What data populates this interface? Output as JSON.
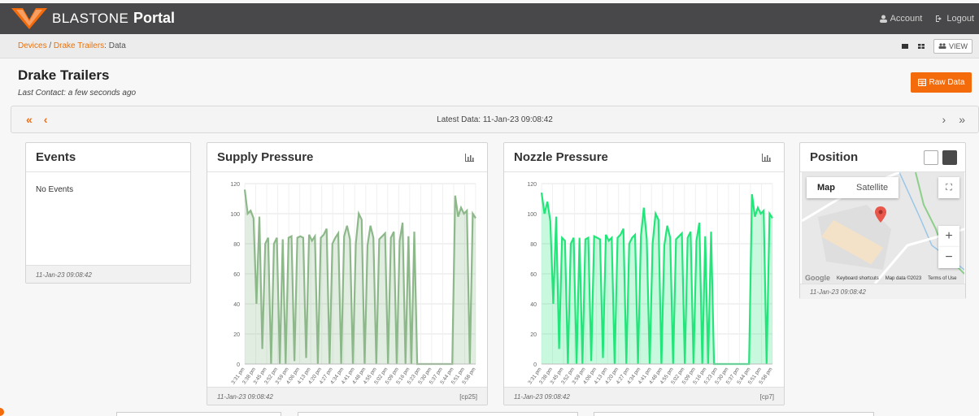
{
  "header": {
    "brand": "BLASTONE",
    "portal": "Portal",
    "account": "Account",
    "logout": "Logout"
  },
  "breadcrumb": {
    "devices": "Devices",
    "sep": "/",
    "trailer": "Drake Trailers",
    "current": ": Data",
    "view_label": "VIEW"
  },
  "page": {
    "title": "Drake Trailers",
    "last_contact": "Last Contact: a few seconds ago",
    "raw_data": "Raw Data"
  },
  "nav": {
    "first": "«",
    "prev": "‹",
    "latest": "Latest Data: 11-Jan-23 09:08:42",
    "next": "›",
    "last": "»"
  },
  "events": {
    "title": "Events",
    "body": "No Events",
    "timestamp": "11-Jan-23 09:08:42"
  },
  "supply": {
    "title": "Supply Pressure",
    "timestamp": "11-Jan-23 09:08:42",
    "code": "[cp25]"
  },
  "nozzle": {
    "title": "Nozzle Pressure",
    "timestamp": "11-Jan-23 09:08:42",
    "code": "[cp7]"
  },
  "position": {
    "title": "Position",
    "map_tab": "Map",
    "satellite_tab": "Satellite",
    "google": "Google",
    "shortcuts": "Keyboard shortcuts",
    "mapdata": "Map data ©2023",
    "terms": "Terms of Use",
    "timestamp": "11-Jan-23 09:08:42"
  },
  "colors": {
    "orange": "#f46b0b",
    "supply": "#8db88a",
    "nozzle": "#22e67a",
    "topbar": "#48484a"
  },
  "chart_data": [
    {
      "type": "area",
      "name": "supply",
      "ylim": [
        0,
        120
      ],
      "yticks": [
        0,
        20,
        40,
        60,
        80,
        100,
        120
      ],
      "x": [
        "3:31 pm",
        "3:38 pm",
        "3:45 pm",
        "3:52 pm",
        "3:59 pm",
        "4:06 pm",
        "4:13 pm",
        "4:20 pm",
        "4:27 pm",
        "4:34 pm",
        "4:41 pm",
        "4:48 pm",
        "4:55 pm",
        "5:02 pm",
        "5:09 pm",
        "5:16 pm",
        "5:23 pm",
        "5:30 pm",
        "5:37 pm",
        "5:44 pm",
        "5:51 pm",
        "5:58 pm"
      ],
      "values": [
        116,
        100,
        102,
        97,
        40,
        98,
        10,
        80,
        84,
        0,
        80,
        84,
        0,
        83,
        0,
        84,
        85,
        2,
        84,
        85,
        84,
        4,
        86,
        82,
        85,
        0,
        84,
        86,
        90,
        0,
        80,
        84,
        87,
        0,
        85,
        92,
        83,
        0,
        80,
        100,
        96,
        0,
        79,
        92,
        84,
        0,
        83,
        85,
        87,
        0,
        84,
        88,
        0,
        82,
        94,
        0,
        85,
        0,
        88,
        0,
        0,
        0,
        0,
        0,
        0,
        0,
        0,
        0,
        0,
        0,
        0,
        0,
        112,
        98,
        104,
        100,
        102,
        0,
        100,
        97
      ]
    },
    {
      "type": "area",
      "name": "nozzle",
      "ylim": [
        0,
        120
      ],
      "yticks": [
        0,
        20,
        40,
        60,
        80,
        100,
        120
      ],
      "x": [
        "3:31 pm",
        "3:38 pm",
        "3:45 pm",
        "3:52 pm",
        "3:59 pm",
        "4:06 pm",
        "4:13 pm",
        "4:20 pm",
        "4:27 pm",
        "4:34 pm",
        "4:41 pm",
        "4:48 pm",
        "4:55 pm",
        "5:02 pm",
        "5:09 pm",
        "5:16 pm",
        "5:23 pm",
        "5:30 pm",
        "5:37 pm",
        "5:44 pm",
        "5:51 pm",
        "5:58 pm"
      ],
      "values": [
        114,
        100,
        108,
        95,
        40,
        98,
        10,
        84,
        82,
        0,
        80,
        84,
        0,
        84,
        0,
        83,
        84,
        2,
        85,
        84,
        83,
        4,
        86,
        82,
        84,
        0,
        84,
        86,
        90,
        0,
        80,
        84,
        86,
        0,
        85,
        104,
        83,
        0,
        80,
        100,
        96,
        0,
        79,
        92,
        84,
        0,
        83,
        85,
        87,
        0,
        84,
        88,
        0,
        82,
        94,
        0,
        85,
        0,
        88,
        0,
        0,
        0,
        0,
        0,
        0,
        0,
        0,
        0,
        0,
        0,
        0,
        0,
        113,
        98,
        104,
        100,
        102,
        0,
        100,
        97
      ]
    }
  ]
}
